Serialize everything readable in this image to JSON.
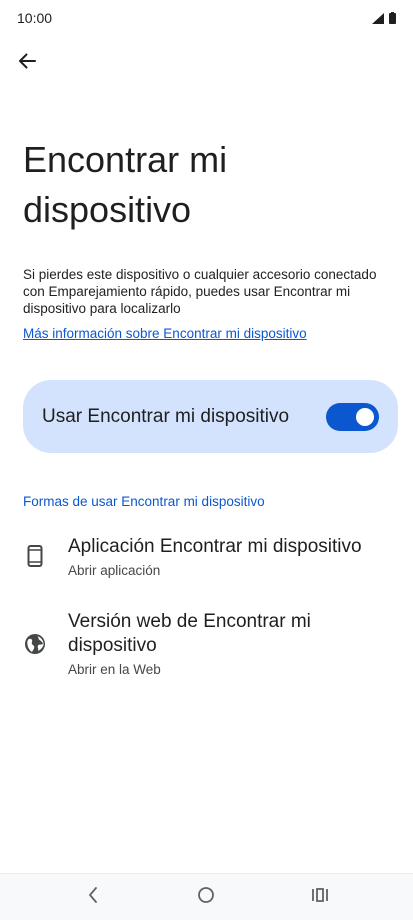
{
  "status_bar": {
    "time": "10:00",
    "icons": [
      "signal-icon",
      "battery-icon"
    ]
  },
  "app_bar": {
    "back_icon": "arrow-back-icon"
  },
  "page": {
    "title": "Encontrar mi dispositivo",
    "description": "Si pierdes este dispositivo o cualquier accesorio conectado con Emparejamiento rápido, puedes usar Encontrar mi dispositivo para localizarlo",
    "learn_more": "Más información sobre Encontrar mi dispositivo"
  },
  "main_toggle": {
    "label": "Usar Encontrar mi dispositivo",
    "checked": true
  },
  "section": {
    "header": "Formas de usar Encontrar mi dispositivo",
    "items": [
      {
        "icon": "phone-icon",
        "title": "Aplicación Encontrar mi dispositivo",
        "subtitle": "Abrir aplicación"
      },
      {
        "icon": "globe-icon",
        "title": "Versión web de Encontrar mi dispositivo",
        "subtitle": "Abrir en la Web"
      }
    ]
  },
  "nav_bar": {
    "buttons": [
      "back-nav-icon",
      "home-nav-icon",
      "recents-nav-icon"
    ]
  },
  "colors": {
    "accent": "#0b57d0",
    "card_background": "#d3e3fd",
    "text_primary": "#1f1f1f",
    "text_secondary": "#444746"
  }
}
